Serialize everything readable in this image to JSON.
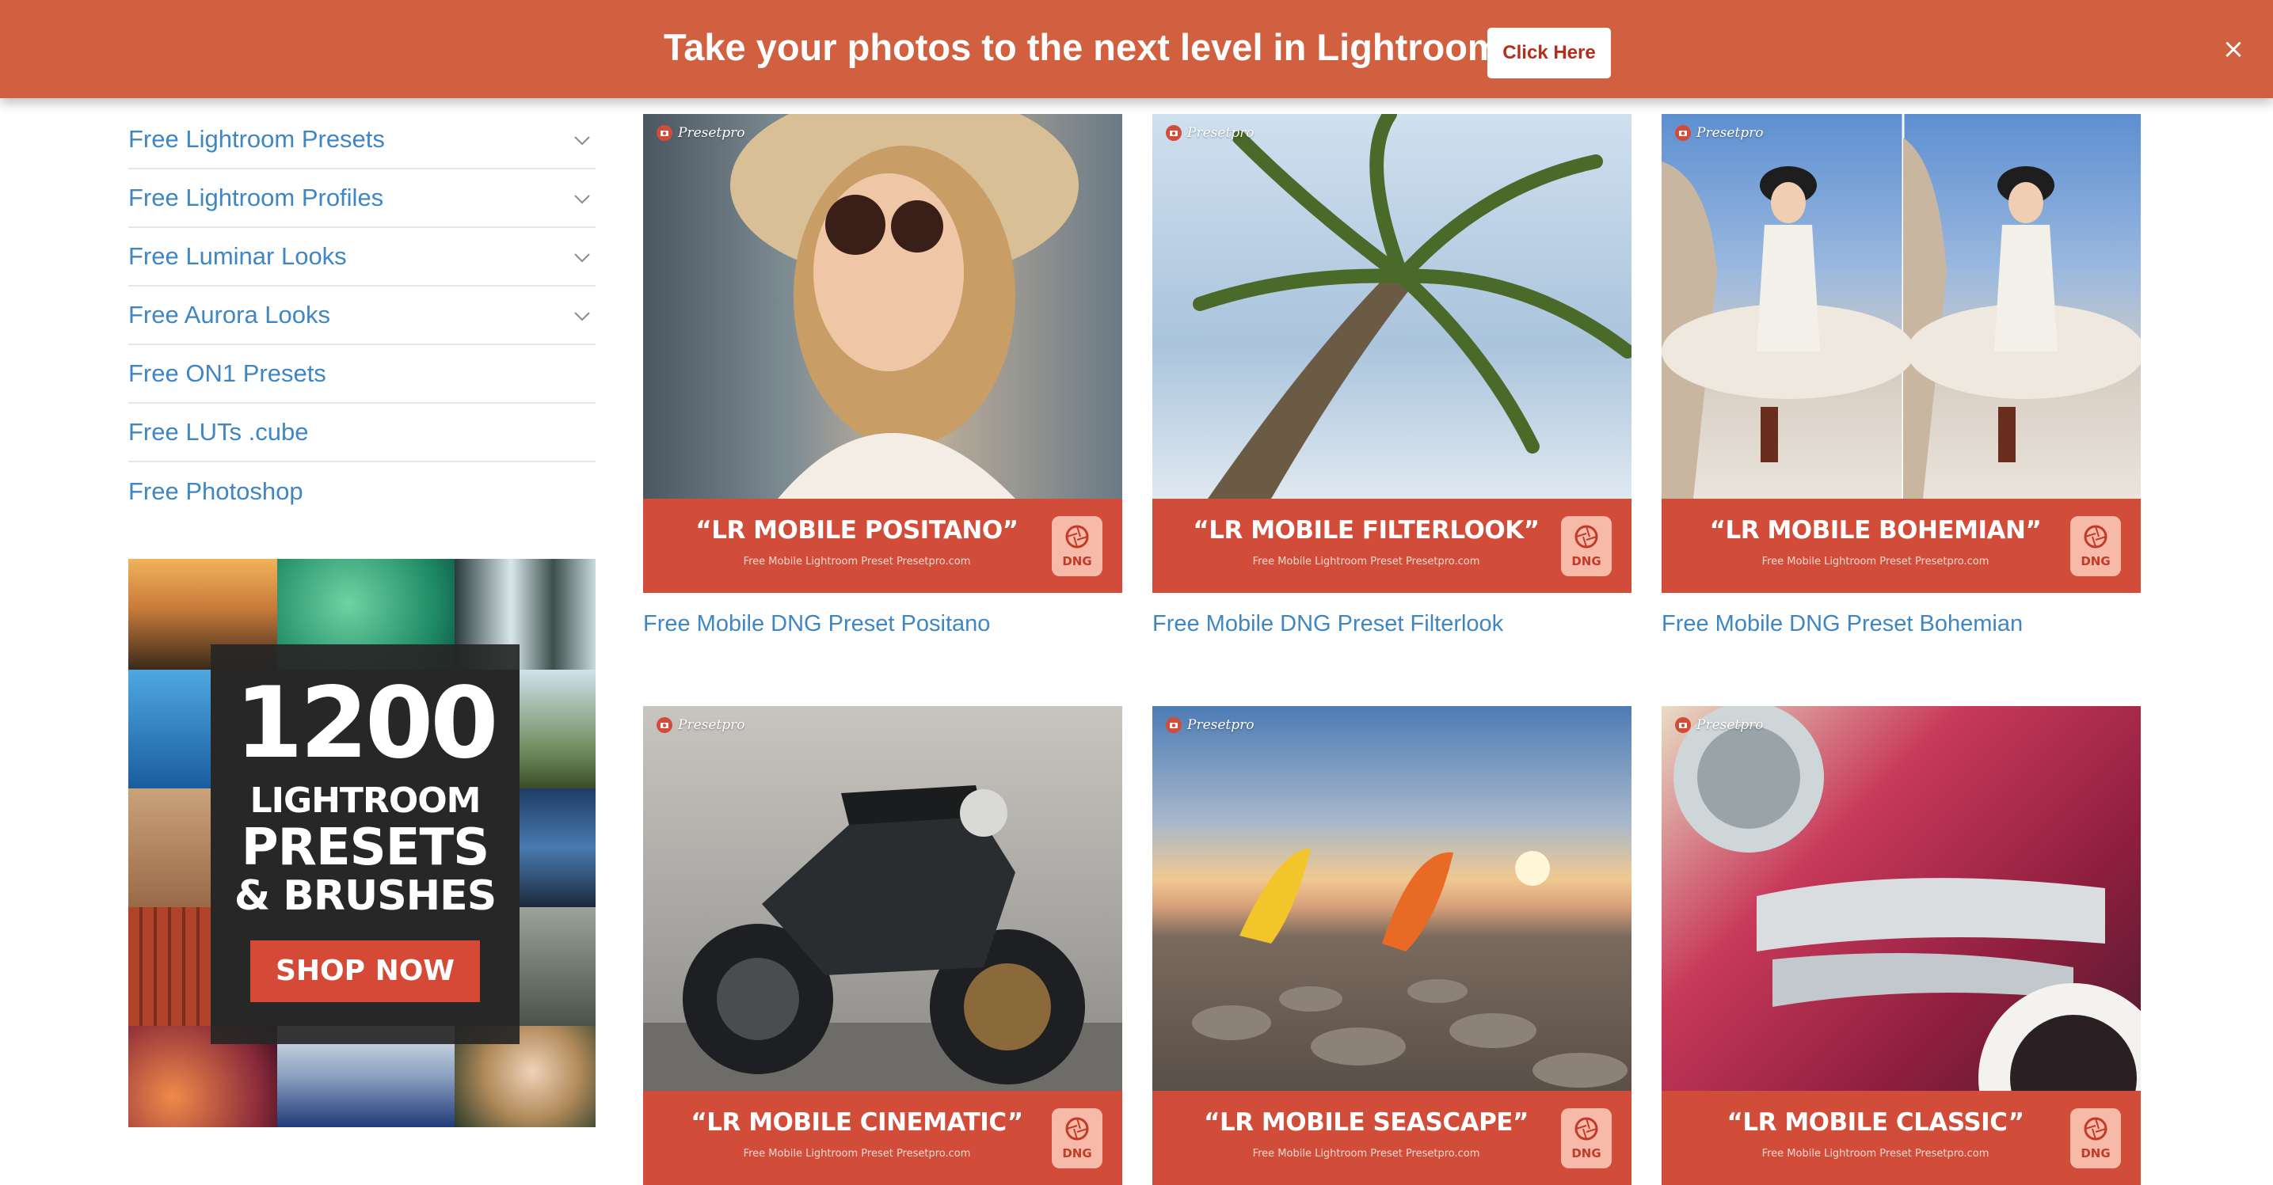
{
  "banner": {
    "text": "Take your photos to the next level in Lightroom!",
    "button_label": "Click Here",
    "close_label": "×",
    "color": "#d0603f"
  },
  "sidebar": {
    "items": [
      {
        "label": "Free Lightroom Presets",
        "has_chevron": true
      },
      {
        "label": "Free Lightroom Profiles",
        "has_chevron": true
      },
      {
        "label": "Free Luminar Looks",
        "has_chevron": true
      },
      {
        "label": "Free Aurora Looks",
        "has_chevron": true
      },
      {
        "label": "Free ON1 Presets",
        "has_chevron": false
      },
      {
        "label": "Free LUTs .cube",
        "has_chevron": false
      },
      {
        "label": "Free Photoshop",
        "has_chevron": false
      }
    ],
    "link_color": "#3f86c4"
  },
  "ad": {
    "number": "1200",
    "line1": "LIGHTROOM",
    "line2": "PRESETS",
    "line3": "& BRUSHES",
    "button": "SHOP NOW"
  },
  "cards": [
    {
      "title": "“LR MOBILE POSITANO”",
      "subtitle": "Free Mobile Lightroom Preset Presetpro.com",
      "badge": "DNG",
      "watermark": "Presetpro",
      "link": "Free Mobile DNG Preset Positano",
      "photo": "woman-hat-icon"
    },
    {
      "title": "“LR MOBILE FILTERLOOK”",
      "subtitle": "Free Mobile Lightroom Preset Presetpro.com",
      "badge": "DNG",
      "watermark": "Presetpro",
      "link": "Free Mobile DNG Preset Filterlook",
      "photo": "palm-tree-icon"
    },
    {
      "title": "“LR MOBILE BOHEMIAN”",
      "subtitle": "Free Mobile Lightroom Preset Presetpro.com",
      "badge": "DNG",
      "watermark": "Presetpro",
      "link": "Free Mobile DNG Preset Bohemian",
      "photo": "woman-rocks-icon"
    },
    {
      "title": "“LR MOBILE CINEMATIC”",
      "subtitle": "Free Mobile Lightroom Preset Presetpro.com",
      "badge": "DNG",
      "watermark": "Presetpro",
      "link": "",
      "photo": "motorcycle-icon"
    },
    {
      "title": "“LR MOBILE SEASCAPE”",
      "subtitle": "Free Mobile Lightroom Preset Presetpro.com",
      "badge": "DNG",
      "watermark": "Presetpro",
      "link": "",
      "photo": "kayaks-icon"
    },
    {
      "title": "“LR MOBILE CLASSIC”",
      "subtitle": "Free Mobile Lightroom Preset Presetpro.com",
      "badge": "DNG",
      "watermark": "Presetpro",
      "link": "",
      "photo": "classic-car-icon"
    }
  ]
}
